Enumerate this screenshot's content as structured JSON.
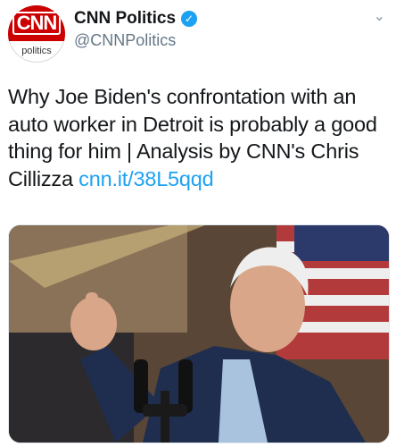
{
  "account": {
    "display_name": "CNN Politics",
    "handle": "@CNNPolitics",
    "verified": true,
    "avatar": {
      "logo_text": "CNN",
      "sub_text": "politics",
      "brand_color": "#cc0000"
    }
  },
  "tweet": {
    "text": "Why Joe Biden's confrontation with an auto worker in Detroit is probably a good thing for him | Analysis by CNN's Chris Cillizza ",
    "link": "cnn.it/38L5qqd",
    "link_color": "#1da1f2"
  },
  "media": {
    "icon": "photo"
  },
  "icons": {
    "verified": "verified-badge-icon",
    "more": "chevron-down-icon"
  }
}
